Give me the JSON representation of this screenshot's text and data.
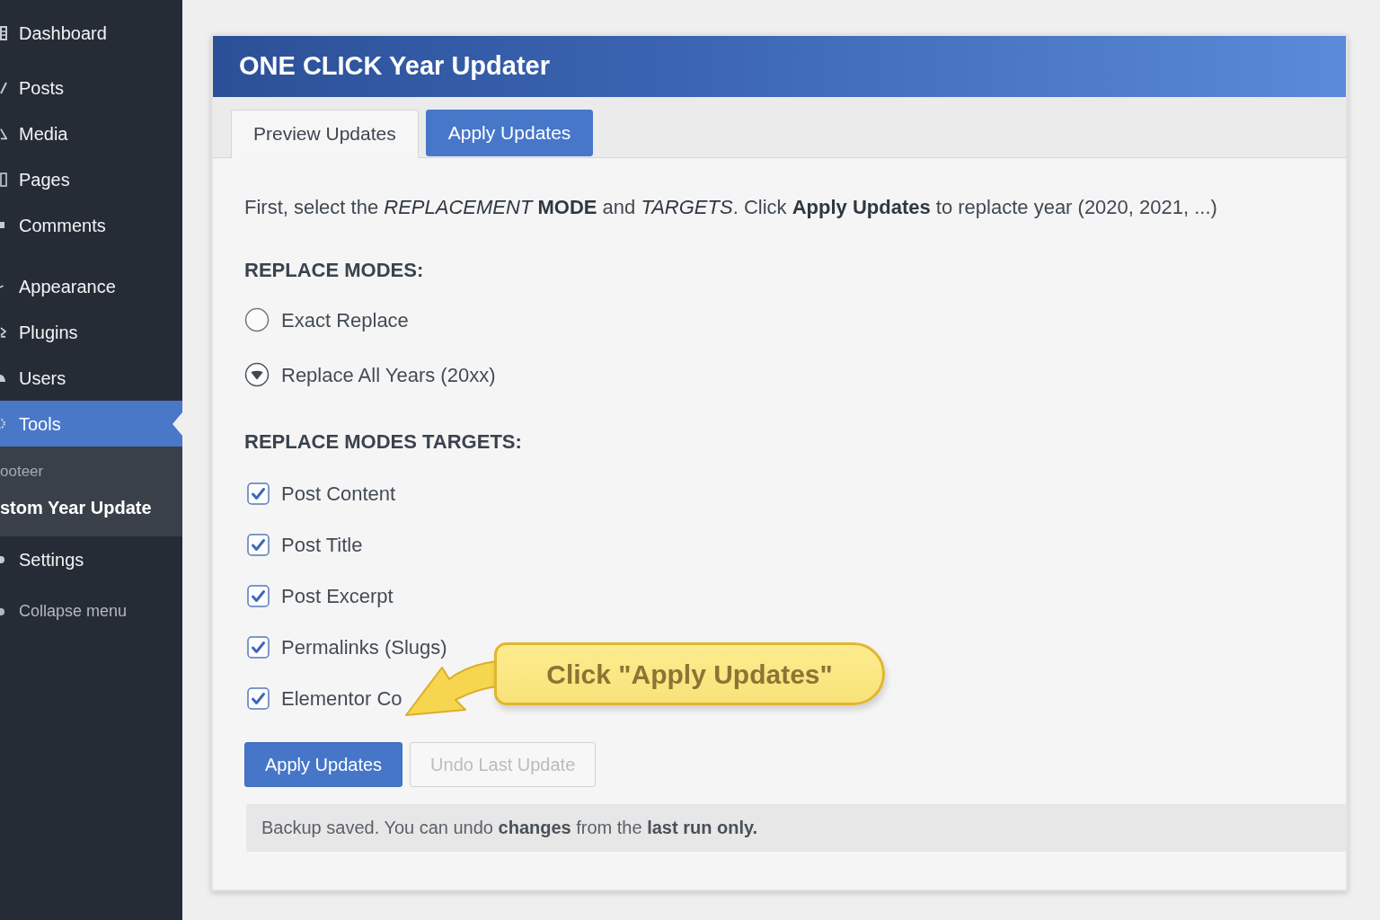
{
  "sidebar": {
    "groups": [
      {
        "items": [
          {
            "label": "Dashboard",
            "kind": "menu",
            "selected": false
          }
        ]
      },
      {
        "items": [
          {
            "label": "Posts",
            "kind": "menu",
            "selected": false
          },
          {
            "label": "Media",
            "kind": "menu",
            "selected": false
          },
          {
            "label": "Pages",
            "kind": "menu",
            "selected": false
          },
          {
            "label": "Comments",
            "kind": "menu",
            "selected": false
          }
        ]
      },
      {
        "items": [
          {
            "label": "Appearance",
            "kind": "menu",
            "selected": false
          },
          {
            "label": "Plugins",
            "kind": "menu",
            "selected": false
          },
          {
            "label": "Users",
            "kind": "menu",
            "selected": false
          },
          {
            "label": "Tools",
            "kind": "menu",
            "selected": true,
            "children": [
              {
                "label": "ooteer",
                "selected": false
              },
              {
                "label": "stom Year Update",
                "selected": true
              }
            ]
          },
          {
            "label": "Settings",
            "kind": "menu",
            "selected": false
          },
          {
            "label": "Collapse menu",
            "kind": "collapse",
            "selected": false
          }
        ]
      }
    ]
  },
  "panel": {
    "title": "ONE CLICK Year Updater",
    "tabs": [
      {
        "label": "Preview Updates",
        "selected": false
      },
      {
        "label": "Apply Updates",
        "selected": true
      }
    ],
    "intro": "First, select the *REPLACEMENT* **MODE** and *TARGETS*. Click **Apply Updates** to replacte year (2020, 2021, ...)",
    "sections": [
      {
        "heading": "REPLACE MODES:",
        "kind": "radio",
        "options": [
          {
            "label": "Exact Replace",
            "selected": false
          },
          {
            "label": "Replace All Years (20xx)",
            "selected": true
          }
        ]
      },
      {
        "heading": "REPLACE MODES TARGETS:",
        "kind": "checkbox",
        "options": [
          {
            "label": "Post Content",
            "checked": true
          },
          {
            "label": "Post Title",
            "checked": true
          },
          {
            "label": "Post Excerpt",
            "checked": true
          },
          {
            "label": "Permalinks (Slugs)",
            "checked": true
          },
          {
            "label": "Elementor Co",
            "checked": true
          }
        ]
      }
    ],
    "callout": {
      "text": "Click \"Apply Updates\""
    },
    "buttons": [
      {
        "label": "Apply Updates",
        "kind": "primary",
        "disabled": false
      },
      {
        "label": "Undo Last Update",
        "kind": "secondary",
        "disabled": true
      }
    ],
    "notice": "Backup saved. You can undo **changes** from the **last run only.**"
  }
}
